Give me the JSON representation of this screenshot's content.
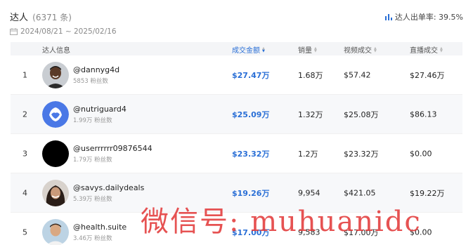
{
  "header": {
    "title": "达人",
    "count": "(6371 条)",
    "rate_label": "达人出单率: 39.5%",
    "date_range": "2024/08/21 ~ 2025/02/16"
  },
  "columns": {
    "info": "达人信息",
    "gmv": "成交金额",
    "sales": "销量",
    "video": "视频成交",
    "live": "直播成交"
  },
  "rows": [
    {
      "rank": "1",
      "handle": "@dannyg4d",
      "fans": "5853 粉丝数",
      "gmv": "$27.47万",
      "sales": "1.68万",
      "video": "$57.42",
      "live": "$27.46万",
      "avatar": "person-dark"
    },
    {
      "rank": "2",
      "handle": "@nutriguard4",
      "fans": "1.99万 粉丝数",
      "gmv": "$25.09万",
      "sales": "1.32万",
      "video": "$25.08万",
      "live": "$86.13",
      "avatar": "blue-logo"
    },
    {
      "rank": "3",
      "handle": "@userrrrrr09876544",
      "fans": "1.79万 粉丝数",
      "gmv": "$23.32万",
      "sales": "1.2万",
      "video": "$23.32万",
      "live": "$0.00",
      "avatar": "black-circle"
    },
    {
      "rank": "4",
      "handle": "@savys.dailydeals",
      "fans": "5.39万 粉丝数",
      "gmv": "$19.26万",
      "sales": "9,954",
      "video": "$421.05",
      "live": "$19.22万",
      "avatar": "person-hair"
    },
    {
      "rank": "5",
      "handle": "@health.suite",
      "fans": "3.46万 粉丝数",
      "gmv": "$17.00万",
      "sales": "9,583",
      "video": "$17.00万",
      "live": "$0.00",
      "avatar": "person-light"
    }
  ],
  "watermark": "微信号: muhuanidc",
  "colors": {
    "accent": "#2a6fd6",
    "watermark": "#e33b3b"
  }
}
